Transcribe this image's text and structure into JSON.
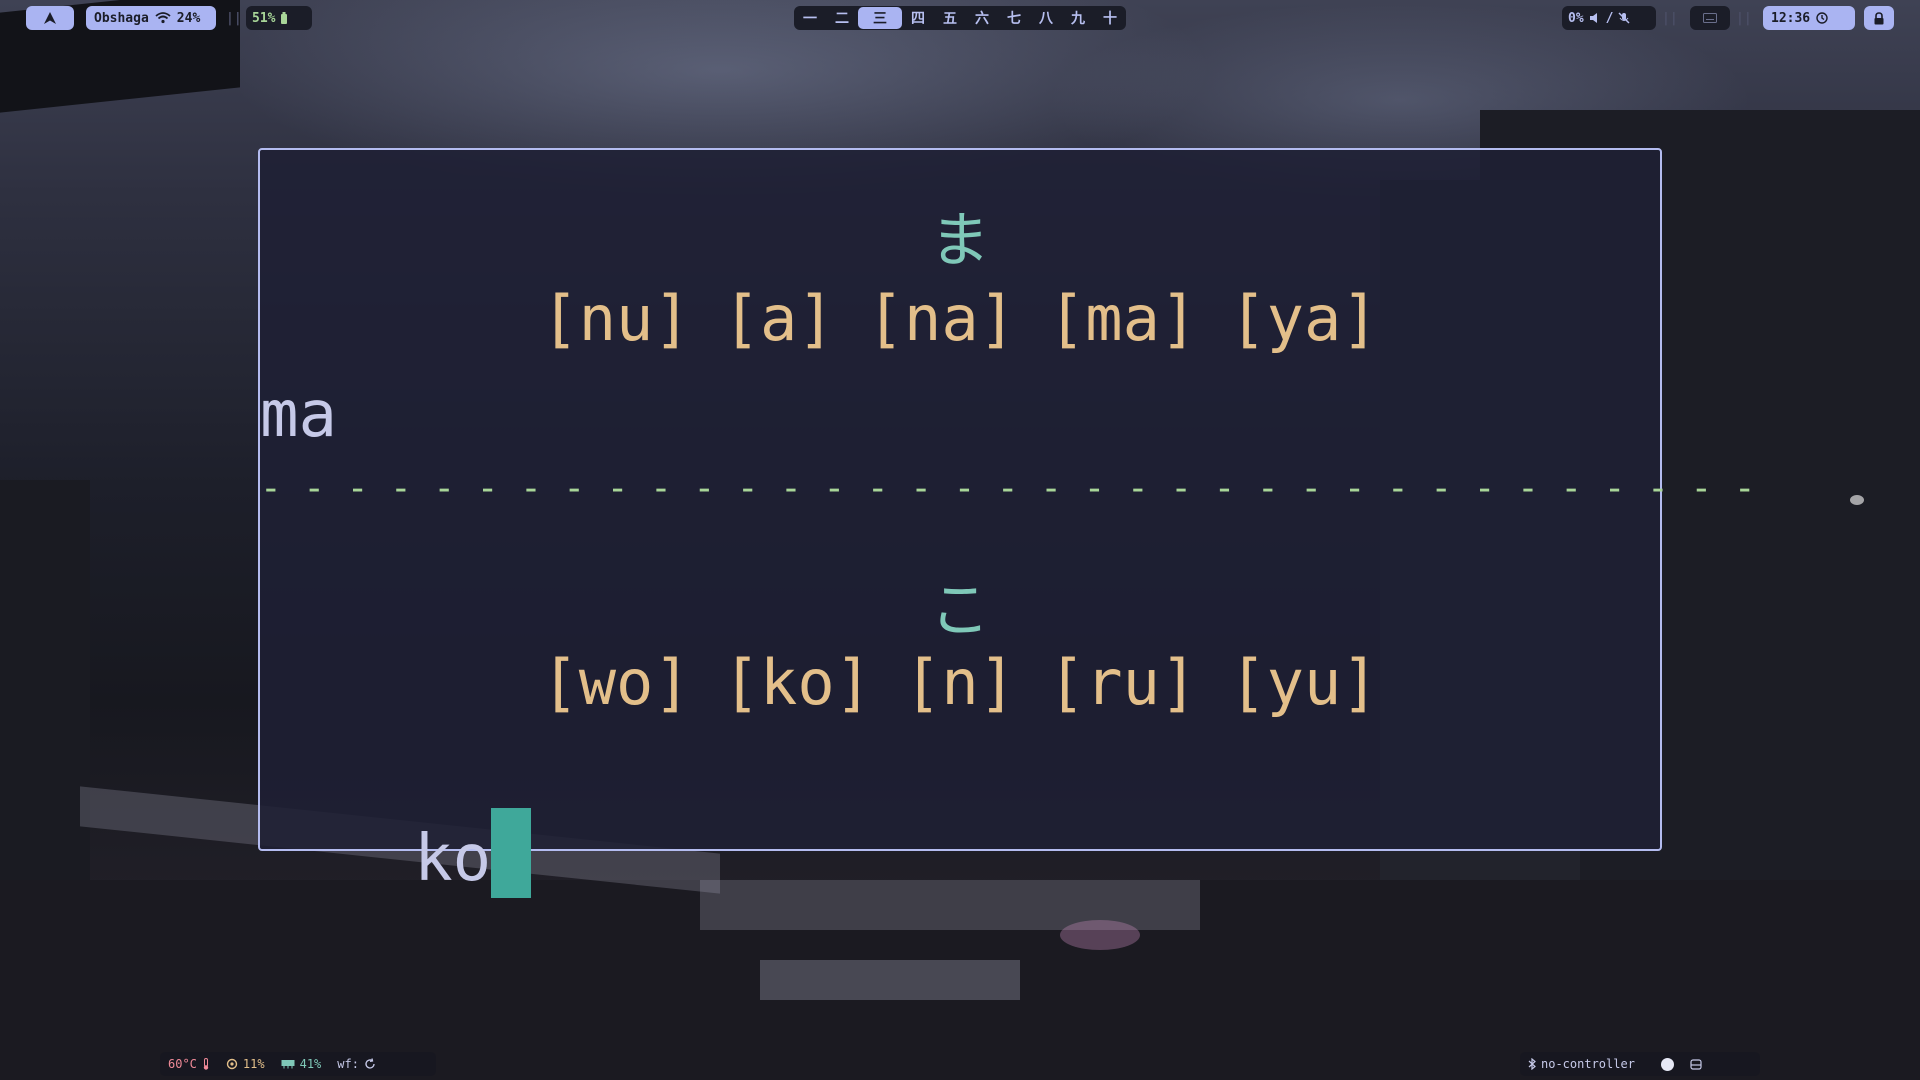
{
  "colors": {
    "accent": "#aab4f2",
    "kana": "#7fc8b8",
    "choices": "#e3bf8a",
    "divider": "#a8d598",
    "cursor": "#3fa89a",
    "temp_hot": "#f08a98",
    "battery": "#a8d598"
  },
  "topbar": {
    "launcher_icon": "arch-logo-icon",
    "network": {
      "name": "Obshaga",
      "signal": "24%",
      "icon": "wifi-icon"
    },
    "sep1": "||",
    "battery": {
      "value": "51%",
      "icon": "battery-icon"
    },
    "workspaces": [
      "一",
      "二",
      "三",
      "四",
      "五",
      "六",
      "七",
      "八",
      "九",
      "十"
    ],
    "active_workspace": "三",
    "volume": {
      "value": "0%",
      "icon": "speaker-icon",
      "slash": "/",
      "mic_icon": "mic-muted-icon"
    },
    "sep2": "||",
    "tray_icon": "keyboard-icon",
    "sep3": "||",
    "clock": {
      "time": "12:36",
      "icon": "clock-icon"
    },
    "lock_icon": "lock-icon"
  },
  "terminal": {
    "q1_kana": "ま",
    "q1_options": [
      "[nu]",
      "[a]",
      "[na]",
      "[ma]",
      "[ya]"
    ],
    "q1_answer": "ma",
    "divider": "- - - - - - - - - - - - - - - - - - - - - - - - - - - - - - - - - - -",
    "q2_kana": "こ",
    "q2_options": [
      "[wo]",
      "[ko]",
      "[n]",
      "[ru]",
      "[yu]"
    ],
    "q2_input": "ko"
  },
  "bottombar": {
    "temp": {
      "value": "60°C",
      "icon": "thermometer-icon"
    },
    "cpu": {
      "value": "11%",
      "icon": "cpu-icon"
    },
    "memory": {
      "value": "41%",
      "icon": "memory-icon"
    },
    "wf": {
      "label": "wf:",
      "icon": "refresh-icon"
    },
    "controller": {
      "value": "no-controller",
      "icon": "bluetooth-icon"
    },
    "toggle_icon": "circle-icon",
    "extra_icon": "tray-icon"
  }
}
